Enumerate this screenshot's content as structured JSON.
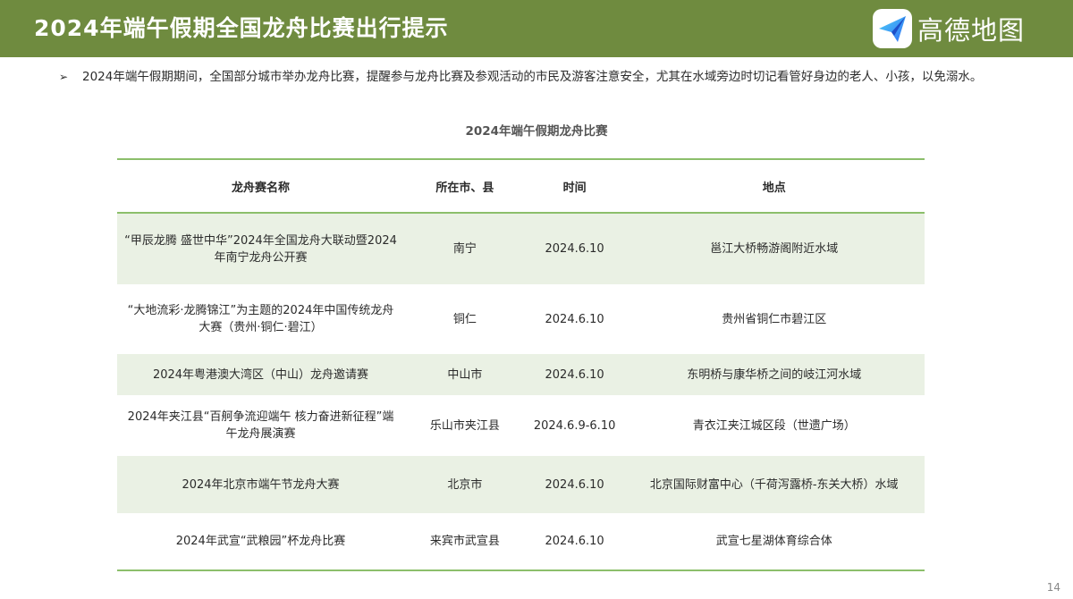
{
  "header": {
    "title": "2024年端午假期全国龙舟比赛出行提示",
    "brand_name": "高德地图",
    "brand_icon": "paper-plane-icon"
  },
  "intro": {
    "bullet": "➢",
    "text": "2024年端午假期期间，全国部分城市举办龙舟比赛，提醒参与龙舟比赛及参观活动的市民及游客注意安全，尤其在水域旁边时切记看管好身边的老人、小孩，以免溺水。"
  },
  "table": {
    "caption": "2024年端午假期龙舟比赛",
    "headers": [
      "龙舟赛名称",
      "所在市、县",
      "时间",
      "地点"
    ],
    "rows": [
      [
        "“甲辰龙腾 盛世中华”2024年全国龙舟大联动暨2024年南宁龙舟公开赛",
        "南宁",
        "2024.6.10",
        "邕江大桥畅游阁附近水域"
      ],
      [
        "“大地流彩·龙腾锦江”为主题的2024年中国传统龙舟大赛（贵州·铜仁·碧江）",
        "铜仁",
        "2024.6.10",
        "贵州省铜仁市碧江区"
      ],
      [
        "2024年粤港澳大湾区（中山）龙舟邀请赛",
        "中山市",
        "2024.6.10",
        "东明桥与康华桥之间的岐江河水域"
      ],
      [
        "2024年夹江县“百舸争流迎端午 核力奋进新征程”端午龙舟展演赛",
        "乐山市夹江县",
        "2024.6.9-6.10",
        "青衣江夹江城区段（世遗广场）"
      ],
      [
        "2024年北京市端午节龙舟大赛",
        "北京市",
        "2024.6.10",
        "北京国际财富中心（千荷泻露桥-东关大桥）水域"
      ],
      [
        "2024年武宣“武粮园”杯龙舟比赛",
        "来宾市武宣县",
        "2024.6.10",
        "武宣七星湖体育综合体"
      ]
    ]
  },
  "page_number": "14",
  "colors": {
    "header_bg": "#6f8b3f",
    "table_rule": "#8cbf6b",
    "row_shade": "#eaf1e4",
    "brand_icon": "#2f7cf6"
  }
}
